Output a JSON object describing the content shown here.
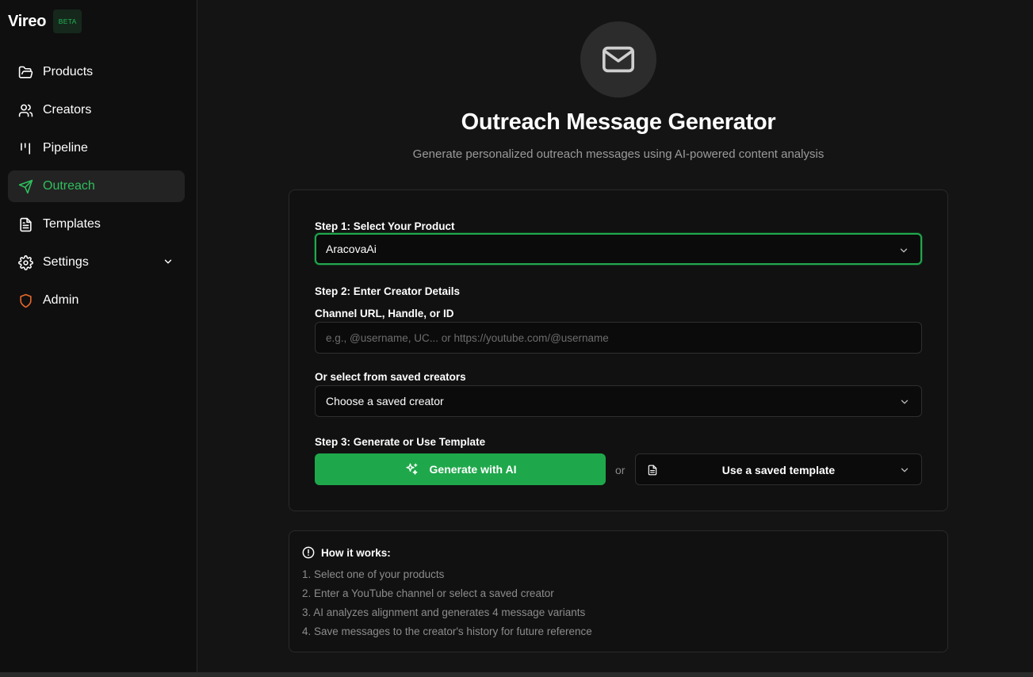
{
  "brand": {
    "name": "Vireo",
    "badge": "BETA"
  },
  "sidebar": {
    "items": [
      {
        "label": "Products",
        "icon": "folder-icon"
      },
      {
        "label": "Creators",
        "icon": "users-icon"
      },
      {
        "label": "Pipeline",
        "icon": "kanban-icon"
      },
      {
        "label": "Outreach",
        "icon": "send-icon",
        "active": true
      },
      {
        "label": "Templates",
        "icon": "file-text-icon"
      },
      {
        "label": "Settings",
        "icon": "gear-icon",
        "expandable": true
      },
      {
        "label": "Admin",
        "icon": "shield-icon"
      }
    ]
  },
  "header": {
    "icon": "mail-icon",
    "title": "Outreach Message Generator",
    "subtitle": "Generate personalized outreach messages using AI-powered content analysis"
  },
  "form": {
    "step1_label": "Step 1: Select Your Product",
    "product_value": "AracovaAi",
    "step2_label": "Step 2: Enter Creator Details",
    "channel_label": "Channel URL, Handle, or ID",
    "channel_placeholder": "e.g., @username, UC... or https://youtube.com/@username",
    "saved_creators_label": "Or select from saved creators",
    "saved_creator_value": "Choose a saved creator",
    "step3_label": "Step 3: Generate or Use Template",
    "generate_label": "Generate with AI",
    "or_text": "or",
    "template_label": "Use a saved template"
  },
  "how_it_works": {
    "title": "How it works:",
    "steps": [
      "1. Select one of your products",
      "2. Enter a YouTube channel or select a saved creator",
      "3. AI analyzes alignment and generates 4 message variants",
      "4. Save messages to the creator's history for future reference"
    ]
  },
  "colors": {
    "accent": "#1fa84b",
    "active_text": "#2ebf5c",
    "admin_icon": "#e8692c",
    "background": "#141414",
    "sidebar_bg": "#0f0f0f"
  }
}
